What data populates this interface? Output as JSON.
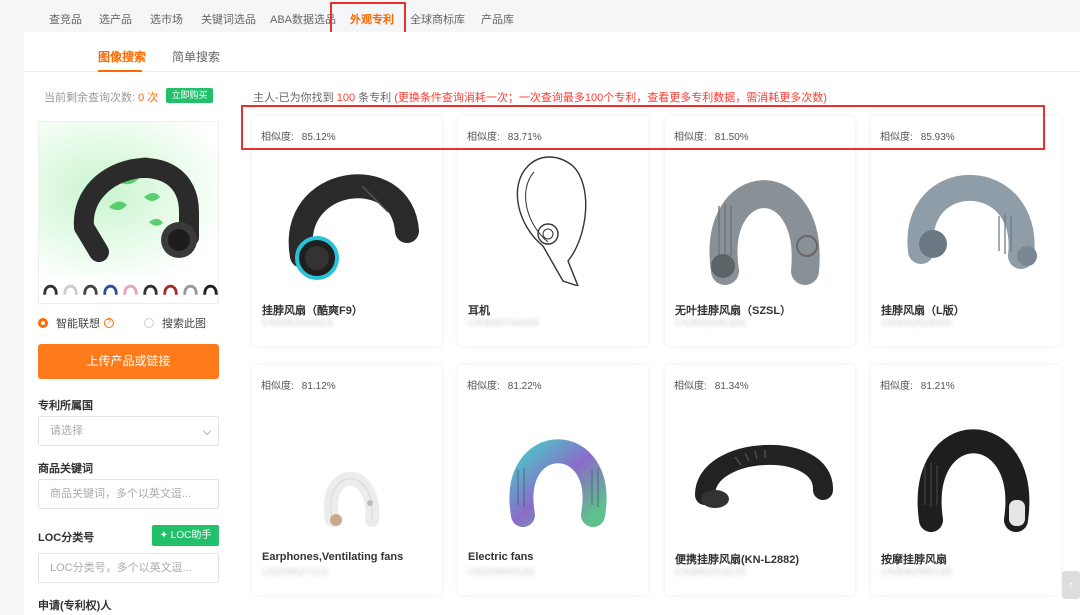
{
  "nav": {
    "items": [
      "查竞品",
      "选产品",
      "选市场",
      "关键词选品",
      "ABA数据选品",
      "外观专利",
      "全球商标库",
      "产品库"
    ],
    "active_index": 5
  },
  "subtabs": [
    "图像搜索",
    "简单搜索"
  ],
  "sidebar": {
    "quota_label": "当前剩余查询次数:",
    "quota_value": "0 次",
    "buy_label": "立即购买",
    "radio_smart": "智能联想",
    "radio_search": "搜索此图",
    "upload_label": "上传产品或链接",
    "country_label": "专利所属国",
    "country_placeholder": "请选择",
    "keyword_label": "商品关键词",
    "keyword_placeholder": "商品关键词，多个以英文逗...",
    "loc_label": "LOC分类号",
    "loc_helper": "LOC助手",
    "loc_placeholder": "LOC分类号，多个以英文逗...",
    "applicant_label": "申请(专利权)人"
  },
  "results": {
    "summary_prefix": "主人-已为你找到",
    "summary_count": "100",
    "summary_unit": "条专利",
    "summary_note": "(更换条件查询消耗一次；一次查询最多100个专利，查看更多专利数据，需消耗更多次数)",
    "similarity_label": "相似度:",
    "cards": [
      {
        "similarity": "85.12%",
        "title": "挂脖风扇（酷爽F9）",
        "patent_no": "CN306291931S",
        "icon": "neck-fan-black-icon"
      },
      {
        "similarity": "83.71%",
        "title": "耳机",
        "patent_no": "CN306274416S",
        "icon": "earhook-sketch-icon"
      },
      {
        "similarity": "81.50%",
        "title": "无叶挂脖风扇（SZSL）",
        "patent_no": "CN306269133S",
        "icon": "neck-fan-grey-icon"
      },
      {
        "similarity": "85.93%",
        "title": "挂脖风扇（L版）",
        "patent_no": "CN306251826S",
        "icon": "neck-fan-blue-grey-icon"
      },
      {
        "similarity": "81.12%",
        "title": "Earphones,Ventilating fans",
        "patent_no": "USD0952711S",
        "icon": "neck-fan-white-icon"
      },
      {
        "similarity": "81.22%",
        "title": "Electric fans",
        "patent_no": "USD0950014S",
        "icon": "neck-fan-iridescent-icon"
      },
      {
        "similarity": "81.34%",
        "title": "便携挂脖风扇(KN-L2882)",
        "patent_no": "CN306291813S",
        "icon": "neck-fan-black-flat-icon"
      },
      {
        "similarity": "81.21%",
        "title": "按摩挂脖风扇",
        "patent_no": "CN306288519S",
        "icon": "neck-fan-black-massage-icon"
      }
    ]
  },
  "colors": {
    "accent": "#ff6a00",
    "green": "#23c06b",
    "highlight_box": "#e8302c"
  }
}
